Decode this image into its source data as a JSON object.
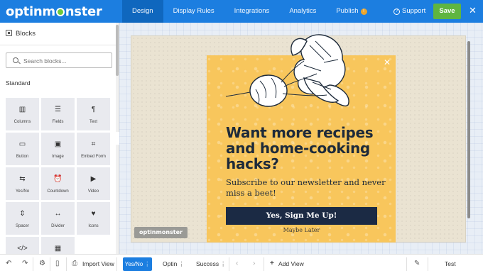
{
  "app": {
    "logo_text": "optinmonster"
  },
  "topbar": {
    "tabs": [
      {
        "label": "Design",
        "active": true
      },
      {
        "label": "Display Rules"
      },
      {
        "label": "Integrations"
      },
      {
        "label": "Analytics"
      },
      {
        "label": "Publish",
        "badge": "!"
      }
    ],
    "support_label": "Support",
    "save_label": "Save",
    "close_icon": "close-icon"
  },
  "sidebar": {
    "title": "Blocks",
    "search_placeholder": "Search blocks...",
    "section_label": "Standard",
    "blocks": [
      {
        "label": "Columns",
        "icon": "▥"
      },
      {
        "label": "Fields",
        "icon": "☰"
      },
      {
        "label": "Text",
        "icon": "¶"
      },
      {
        "label": "Button",
        "icon": "▭"
      },
      {
        "label": "Image",
        "icon": "▣"
      },
      {
        "label": "Embed Form",
        "icon": "⌗"
      },
      {
        "label": "Yes/No",
        "icon": "⇆"
      },
      {
        "label": "Countdown",
        "icon": "⏰"
      },
      {
        "label": "Video",
        "icon": "▶"
      },
      {
        "label": "Spacer",
        "icon": "⇕"
      },
      {
        "label": "Divider",
        "icon": "↔"
      },
      {
        "label": "Icons",
        "icon": "♥"
      },
      {
        "label": "",
        "icon": "</>"
      },
      {
        "label": "",
        "icon": "▦"
      }
    ]
  },
  "popup": {
    "headline": "Want more recipes and home-cooking hacks?",
    "subtext": "Subscribe to our newsletter and never miss a beet!",
    "cta_label": "Yes, Sign Me Up!",
    "secondary_label": "Maybe Later",
    "close_glyph": "✕",
    "brand_badge": "optinmonster",
    "colors": {
      "background": "#f8c65c",
      "button": "#1b2a44",
      "text": "#1d2a3a"
    }
  },
  "bottombar": {
    "import_label": "Import View",
    "views": [
      {
        "label": "Yes/No",
        "active": true
      },
      {
        "label": "Optin"
      },
      {
        "label": "Success"
      }
    ],
    "add_view_label": "Add View",
    "test_label": "Test"
  }
}
